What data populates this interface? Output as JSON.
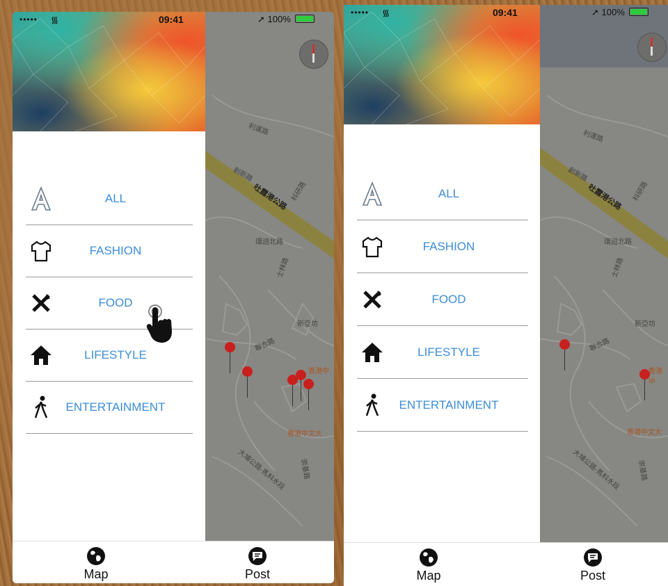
{
  "status_bar": {
    "time": "09:41",
    "battery": "100%",
    "signal": "•••••"
  },
  "menu": {
    "items": [
      {
        "label": "ALL",
        "icon": "letter-a-icon"
      },
      {
        "label": "FASHION",
        "icon": "tshirt-icon"
      },
      {
        "label": "FOOD",
        "icon": "fork-knife-icon"
      },
      {
        "label": "LIFESTYLE",
        "icon": "home-icon"
      },
      {
        "label": "ENTERTAINMENT",
        "icon": "walking-person-icon"
      }
    ]
  },
  "tabs": {
    "map": "Map",
    "post": "Post"
  },
  "map_labels": {
    "road1": "利運路",
    "road2": "創新路",
    "highway": "吐露港公路",
    "road3": "科研路",
    "road4": "環迴北路",
    "road5": "士林路",
    "road6": "新亞坊",
    "road7": "聯合路",
    "poi1": "香港中文大",
    "road8": "大埔公路-馬料水段",
    "road9": "崇基路",
    "poi2": "香港中"
  },
  "colors": {
    "accent": "#3b8cd8",
    "pin": "#c8201e",
    "map_bg": "#8a8a86"
  }
}
